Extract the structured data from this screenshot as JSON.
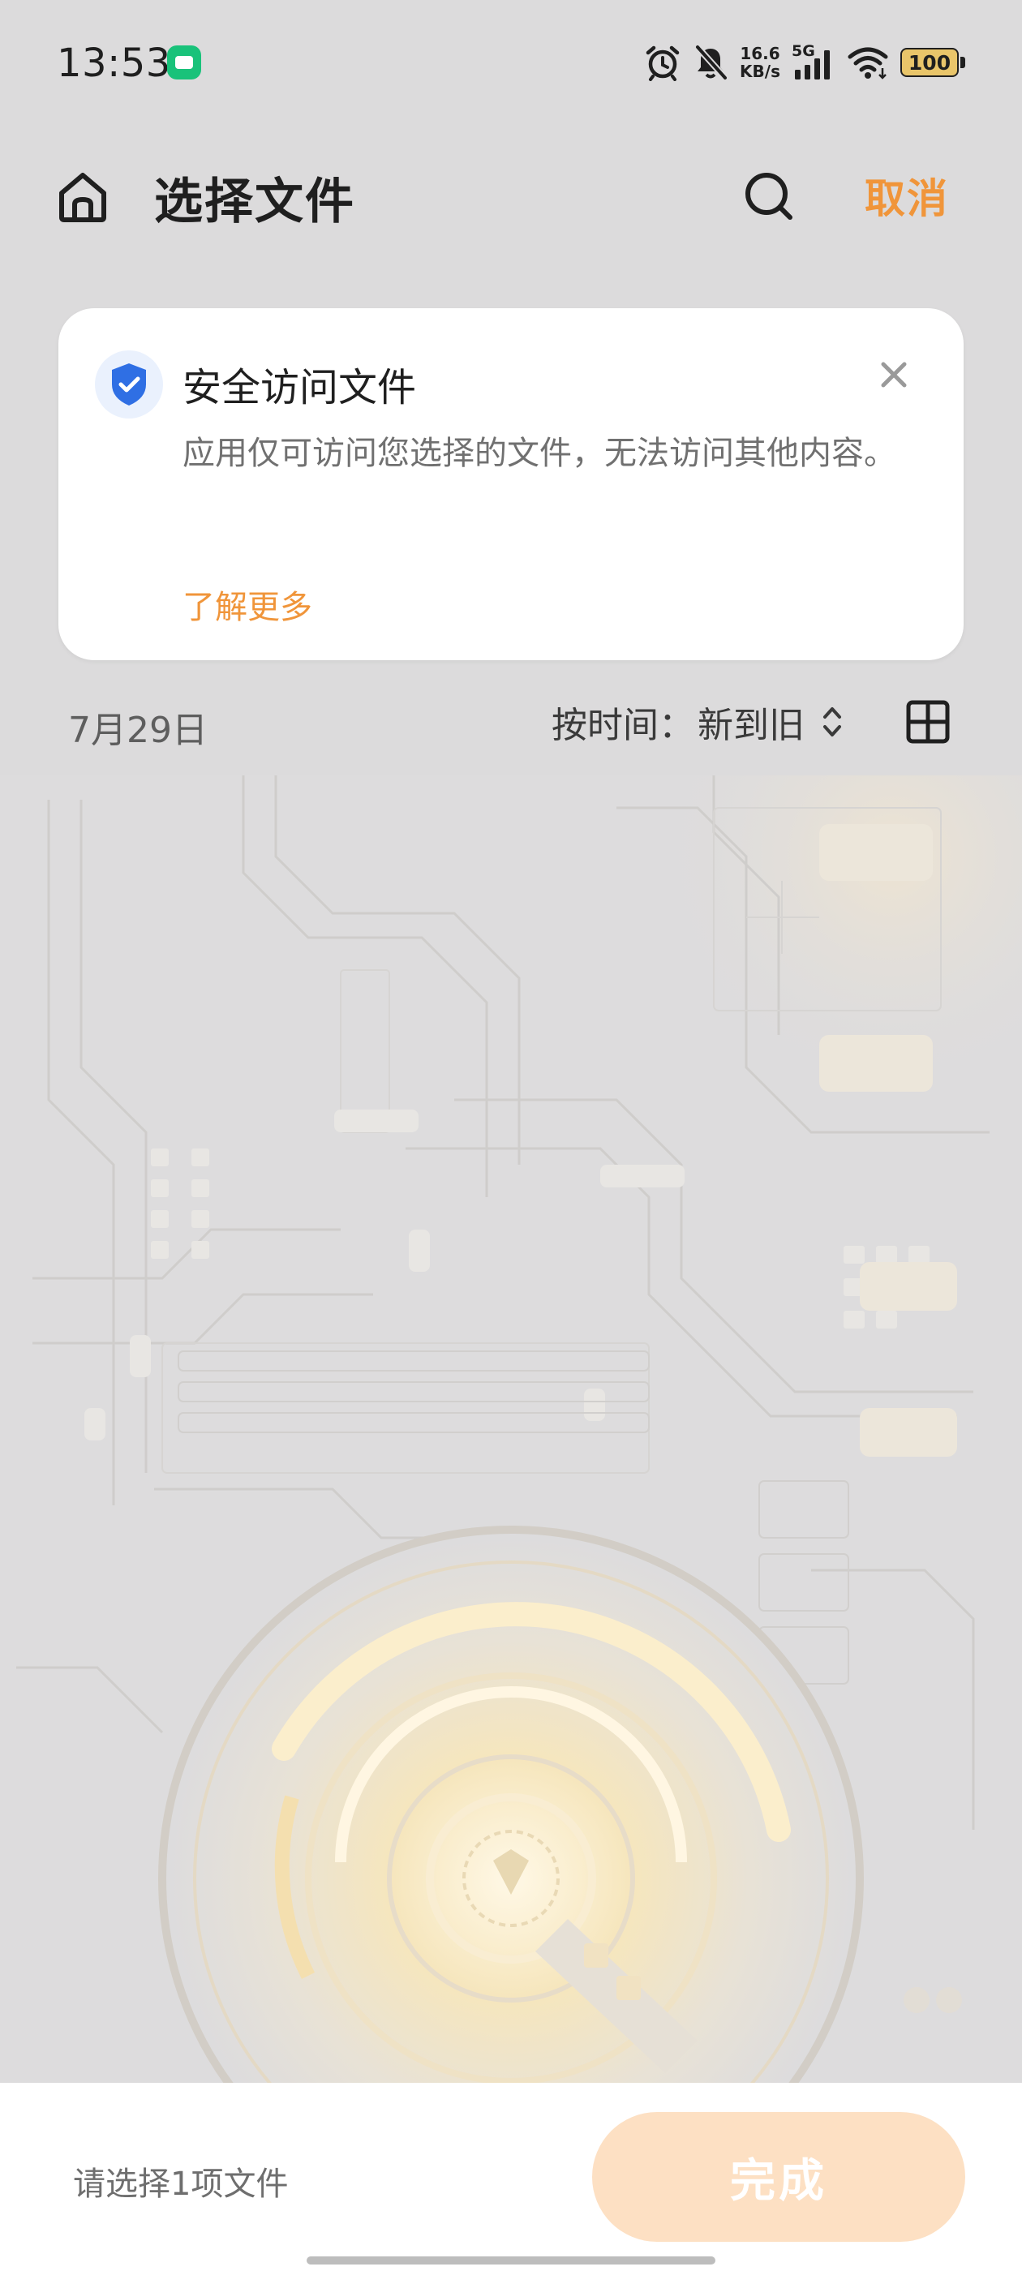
{
  "status_bar": {
    "time": "13:53",
    "net_speed_value": "16.6",
    "net_speed_unit": "KB/s",
    "network_type": "5G",
    "battery": "100"
  },
  "header": {
    "title": "选择文件",
    "cancel_label": "取消"
  },
  "info_card": {
    "title": "安全访问文件",
    "body": "应用仅可访问您选择的文件，无法访问其他内容。",
    "link_label": "了解更多"
  },
  "list_header": {
    "date": "7月29日",
    "sort_prefix": "按时间：",
    "sort_value": "新到旧"
  },
  "bottom_bar": {
    "hint": "请选择1项文件",
    "done_label": "完成"
  },
  "colors": {
    "accent": "#f0953a",
    "done_button_bg": "#fde0c3",
    "shield_blue": "#2f6fe4",
    "page_bg": "#dcdbdc"
  },
  "icons": {
    "home": "home-icon",
    "search": "search-icon",
    "shield": "shield-check-icon",
    "close": "close-icon",
    "sort": "sort-arrows-icon",
    "grid": "grid-view-icon"
  }
}
